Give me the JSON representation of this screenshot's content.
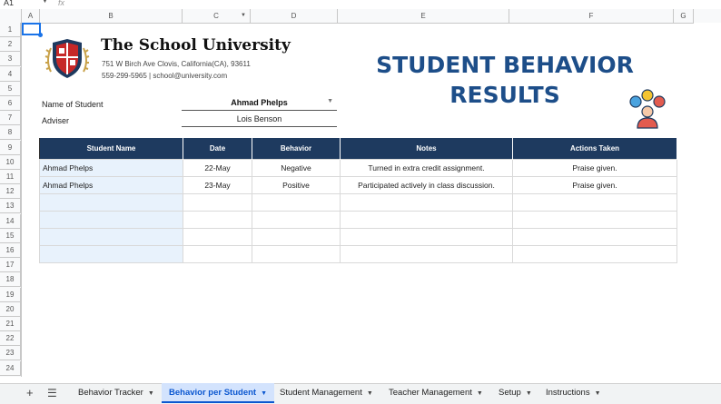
{
  "formula_bar": {
    "cell_ref": "A1",
    "fx": "fx"
  },
  "columns": [
    "A",
    "B",
    "C",
    "D",
    "E",
    "F",
    "G"
  ],
  "rows": [
    "1",
    "2",
    "3",
    "4",
    "5",
    "6",
    "7",
    "8",
    "9",
    "10",
    "11",
    "12",
    "13",
    "14",
    "15",
    "16",
    "17",
    "18",
    "19",
    "20",
    "21",
    "22",
    "23",
    "24"
  ],
  "header": {
    "title": "The School University",
    "address": "751 W Birch Ave Clovis, California(CA), 93611",
    "contact": "559-299-5965 | school@university.com",
    "big_title_line1": "STUDENT BEHAVIOR",
    "big_title_line2": "RESULTS"
  },
  "form": {
    "student_label": "Name of Student",
    "student_value": "Ahmad Phelps",
    "adviser_label": "Adviser",
    "adviser_value": "Lois Benson"
  },
  "table": {
    "headers": [
      "Student Name",
      "Date",
      "Behavior",
      "Notes",
      "Actions Taken"
    ],
    "rows": [
      [
        "Ahmad Phelps",
        "22-May",
        "Negative",
        "Turned in extra credit assignment.",
        "Praise given."
      ],
      [
        "Ahmad Phelps",
        "23-May",
        "Positive",
        "Participated actively in class discussion.",
        "Praise given."
      ],
      [
        "",
        "",
        "",
        "",
        ""
      ],
      [
        "",
        "",
        "",
        "",
        ""
      ],
      [
        "",
        "",
        "",
        "",
        ""
      ],
      [
        "",
        "",
        "",
        "",
        ""
      ]
    ]
  },
  "tabs": [
    {
      "label": "Behavior Tracker",
      "active": false
    },
    {
      "label": "Behavior per Student",
      "active": true
    },
    {
      "label": "Student Management",
      "active": false
    },
    {
      "label": "Teacher Management",
      "active": false
    },
    {
      "label": "Setup",
      "active": false
    },
    {
      "label": "Instructions",
      "active": false
    }
  ],
  "colors": {
    "accent": "#1d4e89",
    "table_header": "#1e3a5f",
    "name_fill": "#e8f2fc",
    "active_tab": "#d3e3fd"
  }
}
